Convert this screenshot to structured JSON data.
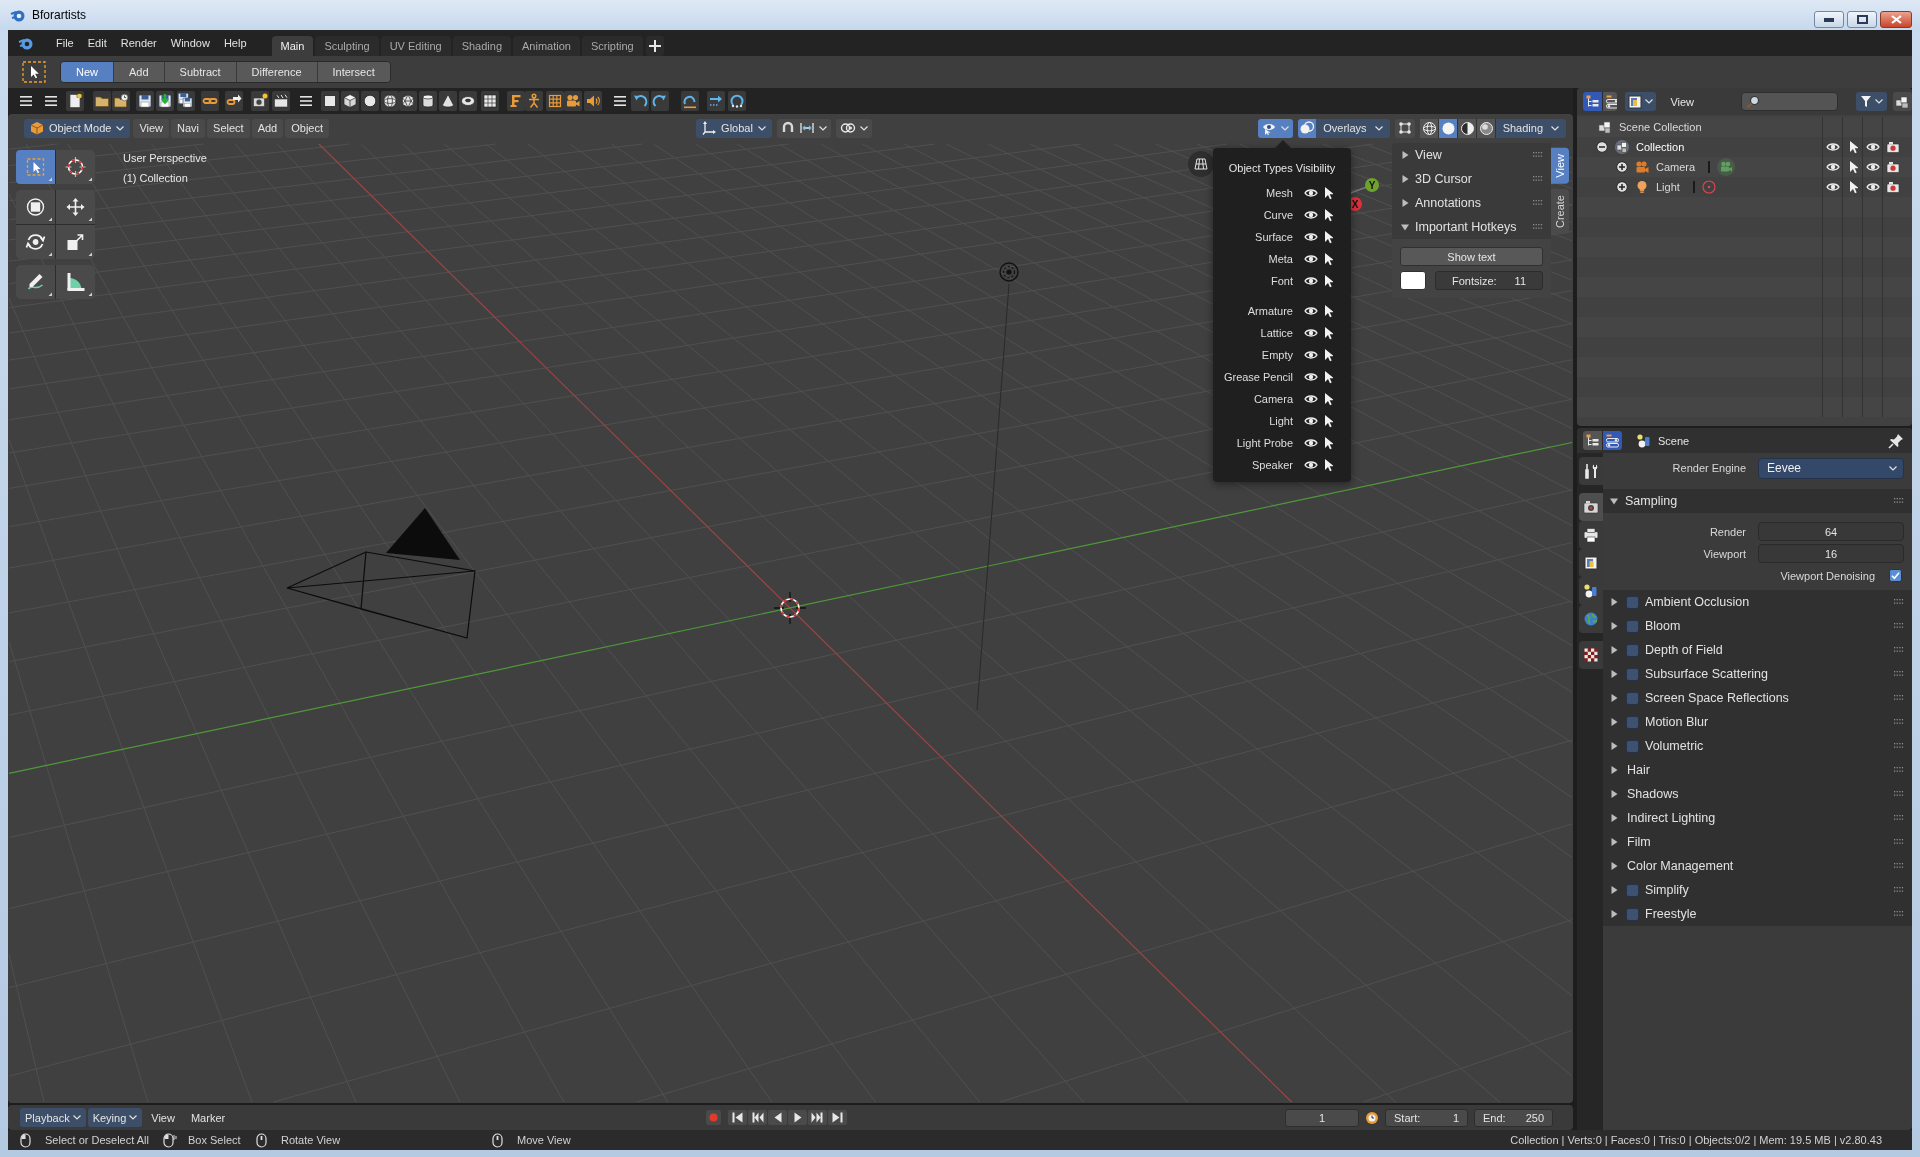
{
  "window": {
    "title": "Bforartists"
  },
  "topbar": {
    "menus": [
      "File",
      "Edit",
      "Render",
      "Window",
      "Help"
    ],
    "workspaces": [
      {
        "label": "Main",
        "selected": true
      },
      {
        "label": "Sculpting",
        "selected": false
      },
      {
        "label": "UV Editing",
        "selected": false
      },
      {
        "label": "Shading",
        "selected": false
      },
      {
        "label": "Animation",
        "selected": false
      },
      {
        "label": "Scripting",
        "selected": false
      }
    ]
  },
  "tool_settings": {
    "operations": [
      {
        "label": "New",
        "selected": true
      },
      {
        "label": "Add",
        "selected": false
      },
      {
        "label": "Subtract",
        "selected": false
      },
      {
        "label": "Difference",
        "selected": false
      },
      {
        "label": "Intersect",
        "selected": false
      }
    ]
  },
  "viewport": {
    "header": {
      "mode": "Object Mode",
      "menus": [
        "View",
        "Navi",
        "Select",
        "Add",
        "Object"
      ],
      "orientation": "Global",
      "object_types_open": true,
      "overlays": "Overlays",
      "shading": "Shading",
      "shading_modes": [
        {
          "kind": "wireframe",
          "selected": false
        },
        {
          "kind": "solid",
          "selected": true
        },
        {
          "kind": "material",
          "selected": false
        },
        {
          "kind": "rendered",
          "selected": false
        }
      ]
    },
    "tool_groups": [
      [
        {
          "kind": "select_box",
          "selected": true
        },
        {
          "kind": "cursor",
          "selected": false
        }
      ],
      [
        {
          "kind": "transform",
          "selected": false
        },
        {
          "kind": "move",
          "selected": false
        },
        {
          "kind": "rotate",
          "selected": false
        },
        {
          "kind": "scale",
          "selected": false
        }
      ],
      [
        {
          "kind": "annotate",
          "selected": false
        },
        {
          "kind": "measure",
          "selected": false
        }
      ]
    ],
    "info": [
      "User Perspective",
      "(1) Collection"
    ],
    "gizmo_axes": [
      {
        "label": "Y",
        "color": "#6ea22e"
      },
      {
        "label": "X",
        "color": "#e0303b"
      }
    ],
    "object_types_popover": {
      "title": "Object Types Visibility",
      "groups": [
        [
          {
            "name": "Mesh",
            "visible": true,
            "selectable": true
          },
          {
            "name": "Curve",
            "visible": true,
            "selectable": true
          },
          {
            "name": "Surface",
            "visible": true,
            "selectable": true
          },
          {
            "name": "Meta",
            "visible": true,
            "selectable": true
          },
          {
            "name": "Font",
            "visible": true,
            "selectable": true
          }
        ],
        [
          {
            "name": "Armature",
            "visible": true,
            "selectable": true
          },
          {
            "name": "Lattice",
            "visible": true,
            "selectable": true
          },
          {
            "name": "Empty",
            "visible": true,
            "selectable": true
          },
          {
            "name": "Grease Pencil",
            "visible": true,
            "selectable": true
          },
          {
            "name": "Camera",
            "visible": true,
            "selectable": true
          },
          {
            "name": "Light",
            "visible": true,
            "selectable": true
          },
          {
            "name": "Light Probe",
            "visible": true,
            "selectable": true
          },
          {
            "name": "Speaker",
            "visible": true,
            "selectable": true
          }
        ]
      ]
    },
    "sidebar": {
      "tabs": [
        {
          "label": "View",
          "selected": true
        },
        {
          "label": "Create",
          "selected": false
        }
      ],
      "panels": [
        {
          "title": "View",
          "expanded": false
        },
        {
          "title": "3D Cursor",
          "expanded": false
        },
        {
          "title": "Annotations",
          "expanded": false
        },
        {
          "title": "Important Hotkeys",
          "expanded": true
        }
      ],
      "hotkeys": {
        "button": "Show text",
        "fontsize_label": "Fontsize:",
        "fontsize": "11"
      }
    }
  },
  "outliner": {
    "editor_switch": [
      {
        "kind": "outliner",
        "selected": true
      },
      {
        "kind": "properties",
        "selected": false
      }
    ],
    "view_menu": "View",
    "tree": [
      {
        "name": "Scene Collection",
        "kind": "scene_collection",
        "children": [
          {
            "name": "Collection",
            "kind": "collection",
            "expanded": true,
            "children": [
              {
                "name": "Camera",
                "kind": "camera",
                "expanded": false
              },
              {
                "name": "Light",
                "kind": "light",
                "expanded": false
              }
            ]
          }
        ]
      }
    ]
  },
  "properties": {
    "editor_switch": [
      {
        "kind": "outliner",
        "selected": false
      },
      {
        "kind": "properties",
        "selected": true
      }
    ],
    "context": "Scene",
    "tab_groups": [
      [
        {
          "kind": "tool",
          "selected": false
        }
      ],
      [
        {
          "kind": "render",
          "selected": true
        },
        {
          "kind": "output",
          "selected": false
        },
        {
          "kind": "view_layer",
          "selected": false
        },
        {
          "kind": "scene",
          "selected": false
        },
        {
          "kind": "world",
          "selected": false
        }
      ],
      [
        {
          "kind": "texture",
          "selected": false
        }
      ]
    ],
    "render_engine": {
      "label": "Render Engine",
      "value": "Eevee"
    },
    "sampling": {
      "title": "Sampling",
      "expanded": true,
      "fields": [
        {
          "label": "Render",
          "value": "64"
        },
        {
          "label": "Viewport",
          "value": "16"
        }
      ],
      "denoising": {
        "label": "Viewport Denoising",
        "checked": true
      }
    },
    "panels": [
      {
        "title": "Ambient Occlusion",
        "kind": "toggle",
        "checked": false,
        "expanded": false
      },
      {
        "title": "Bloom",
        "kind": "toggle",
        "checked": false,
        "expanded": false
      },
      {
        "title": "Depth of Field",
        "kind": "toggle",
        "checked": false,
        "expanded": false
      },
      {
        "title": "Subsurface Scattering",
        "kind": "toggle",
        "checked": false,
        "expanded": false
      },
      {
        "title": "Screen Space Reflections",
        "kind": "toggle",
        "checked": false,
        "expanded": false
      },
      {
        "title": "Motion Blur",
        "kind": "toggle",
        "checked": false,
        "expanded": false
      },
      {
        "title": "Volumetric",
        "kind": "toggle",
        "checked": false,
        "expanded": false
      },
      {
        "title": "Hair",
        "kind": "plain",
        "expanded": false
      },
      {
        "title": "Shadows",
        "kind": "plain",
        "expanded": false
      },
      {
        "title": "Indirect Lighting",
        "kind": "plain",
        "expanded": false
      },
      {
        "title": "Film",
        "kind": "plain",
        "expanded": false
      },
      {
        "title": "Color Management",
        "kind": "plain",
        "expanded": false
      },
      {
        "title": "Simplify",
        "kind": "toggle",
        "checked": false,
        "expanded": false
      },
      {
        "title": "Freestyle",
        "kind": "toggle",
        "checked": false,
        "expanded": false
      }
    ]
  },
  "timeline": {
    "menus": [
      {
        "label": "Playback",
        "kind": "dropdown"
      },
      {
        "label": "Keying",
        "kind": "dropdown"
      },
      {
        "label": "View",
        "kind": "menu"
      },
      {
        "label": "Marker",
        "kind": "menu"
      }
    ],
    "current_frame": "1",
    "start": {
      "label": "Start:",
      "value": "1"
    },
    "end": {
      "label": "End:",
      "value": "250"
    }
  },
  "status_bar": {
    "hints": [
      {
        "kind": "left_click",
        "label": "Select or Deselect All"
      },
      {
        "kind": "left_drag",
        "label": "Box Select"
      },
      {
        "kind": "middle_drag",
        "label": "Rotate View"
      },
      {
        "kind": "middle_drag",
        "label": "Move View"
      }
    ],
    "stats": "Collection | Verts:0 | Faces:0 | Tris:0 | Objects:0/2 | Mem: 19.5 MB | v2.80.43"
  }
}
